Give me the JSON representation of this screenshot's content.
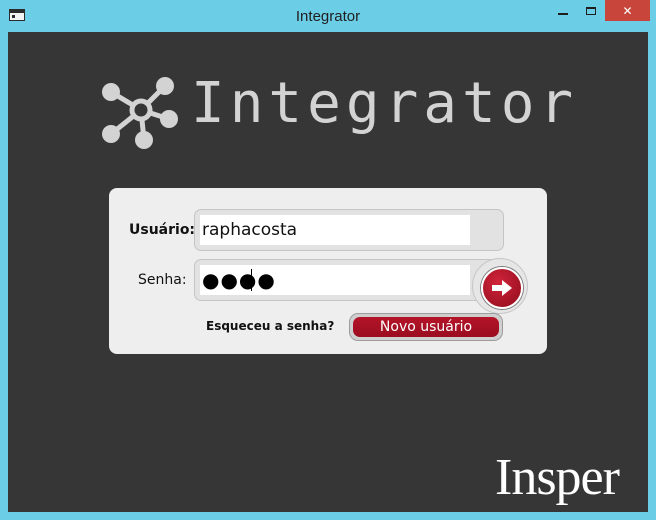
{
  "window": {
    "title": "Integrator"
  },
  "controls": {
    "close_glyph": "✕"
  },
  "brand": {
    "app_name": "Integrator",
    "institution": "Insper"
  },
  "login": {
    "username_label": "Usuário:",
    "username_value": "raphacosta",
    "password_label": "Senha:",
    "password_mask": "●●●●",
    "forgot_link": "Esqueceu a senha?",
    "new_user_button": "Novo usuário"
  },
  "icons": {
    "app": "window-icon",
    "logo": "network-hub-icon",
    "submit": "arrow-right-icon"
  },
  "colors": {
    "titlebar": "#6ccde6",
    "client_background": "#363636",
    "panel": "#eeeeee",
    "accent_red": "#b51428",
    "close_button": "#c7453a",
    "logo_gray": "#d3d3d3"
  }
}
